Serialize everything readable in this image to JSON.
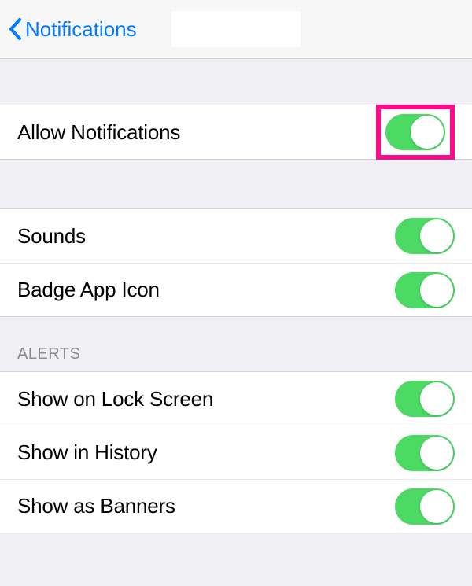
{
  "nav": {
    "back_label": "Notifications"
  },
  "group1": {
    "allow_label": "Allow Notifications",
    "highlighted": true
  },
  "group2": {
    "rows": [
      {
        "label": "Sounds"
      },
      {
        "label": "Badge App Icon"
      }
    ]
  },
  "alerts": {
    "header": "ALERTS",
    "rows": [
      {
        "label": "Show on Lock Screen"
      },
      {
        "label": "Show in History"
      },
      {
        "label": "Show as Banners"
      }
    ]
  },
  "toggles": {
    "allow": true,
    "sounds": true,
    "badge": true,
    "lock_screen": true,
    "history": true,
    "banners": true
  },
  "colors": {
    "accent": "#007aff",
    "toggle_on": "#4cd964",
    "highlight": "#ff0a88"
  }
}
